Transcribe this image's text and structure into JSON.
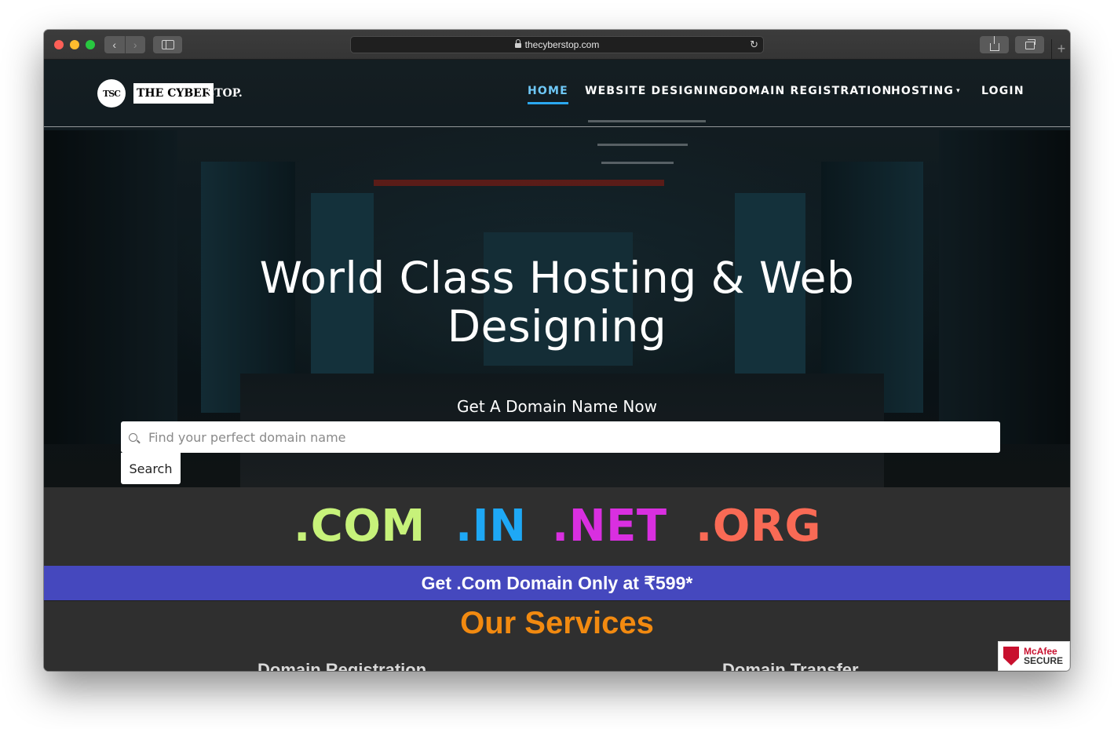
{
  "browser": {
    "url": "thecyberstop.com",
    "nav_back": "‹",
    "nav_forward": "›",
    "reload": "↻",
    "new_tab": "+"
  },
  "site": {
    "logo_mark": "TSC",
    "logo_text_boxed": "THE CYBER",
    "logo_text_rest": "STOP."
  },
  "nav": {
    "items": [
      {
        "label": "HOME",
        "active": true
      },
      {
        "label": "WEBSITE DESIGNING",
        "active": false
      },
      {
        "label": "DOMAIN REGISTRATION",
        "active": false
      },
      {
        "label": "HOSTING",
        "active": false,
        "dropdown": true
      },
      {
        "label": "LOGIN",
        "active": false
      }
    ],
    "caret": "▾"
  },
  "hero": {
    "title_line1": "World Class Hosting & Web",
    "title_line2": "Designing",
    "subtitle": "Get A Domain Name Now",
    "search_placeholder": "Find your perfect domain name",
    "search_button": "Search"
  },
  "tlds": [
    {
      "label": ".COM",
      "color": "#c7f27a"
    },
    {
      "label": ".IN",
      "color": "#1ea8f5"
    },
    {
      "label": ".NET",
      "color": "#d92fe0"
    },
    {
      "label": ".ORG",
      "color": "#f96a55"
    }
  ],
  "promo": {
    "text": "Get .Com Domain Only at ₹599*"
  },
  "services": {
    "title": "Our Services",
    "items": [
      "Domain Registration",
      "Domain Transfer"
    ]
  },
  "badge": {
    "brand": "McAfee",
    "label": "SECURE"
  },
  "colors": {
    "accent": "#2ba8f0",
    "promo_bg": "#4548be",
    "services_title": "#f28a10"
  }
}
